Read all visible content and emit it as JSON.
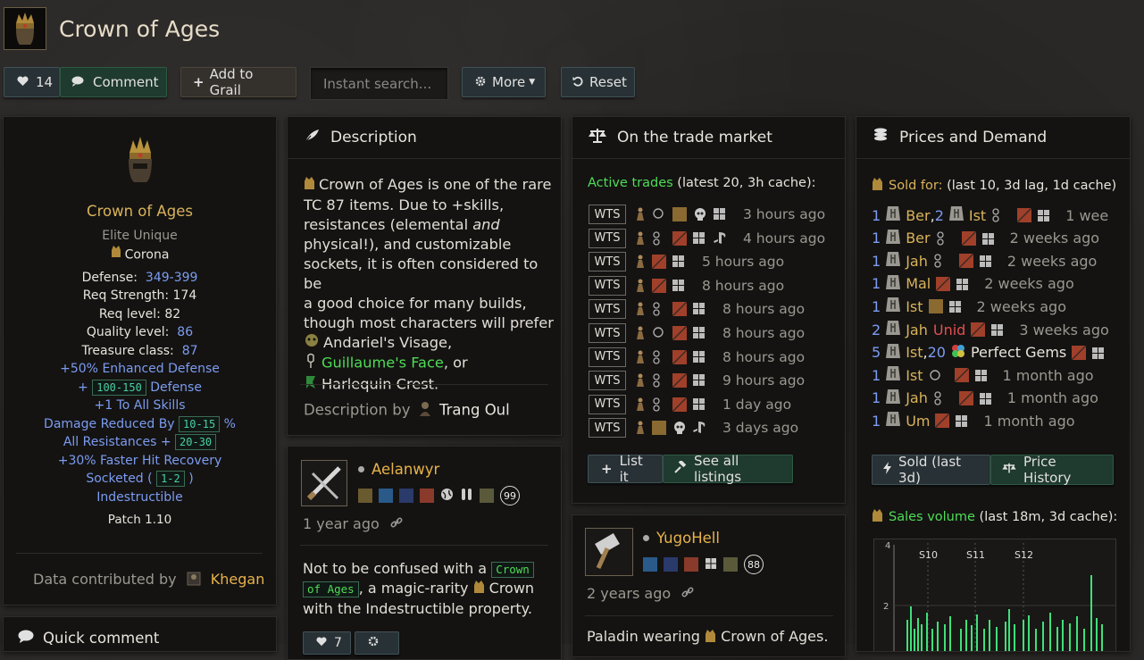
{
  "header": {
    "title": "Crown of Ages"
  },
  "toolbar": {
    "likes": "14",
    "comment": "Comment",
    "grail": "Add to Grail",
    "search_placeholder": "Instant search...",
    "more": "More",
    "reset": "Reset"
  },
  "item": {
    "name": "Crown of Ages",
    "rarity": "Elite Unique",
    "base": "Corona",
    "defense_label": "Defense:",
    "defense_value": "349-399",
    "req_str": "Req Strength: 174",
    "req_lvl": "Req level: 82",
    "quality_label": "Quality level:",
    "quality_value": "86",
    "tc_label": "Treasure class:",
    "tc_value": "87",
    "mods": {
      "ed": "+50% Enhanced Defense",
      "def_prefix": "+",
      "def_range": "100-150",
      "def_suffix": "Defense",
      "skills": "+1 To All Skills",
      "dr_prefix": "Damage Reduced By",
      "dr_range": "10-15",
      "dr_suffix": "%",
      "res_prefix": "All Resistances +",
      "res_range": "20-30",
      "fhr": "+30% Faster Hit Recovery",
      "sock_prefix": "Socketed (",
      "sock_range": "1-2",
      "sock_suffix": ")",
      "indestr": "Indestructible"
    },
    "patch": "Patch 1.10",
    "contrib_label": "Data contributed by",
    "contrib_user": "Khegan"
  },
  "quick_comment": {
    "title": "Quick comment"
  },
  "description": {
    "title": "Description",
    "line1_name": "Crown of Ages",
    "line1_rest": " is one of the rare",
    "line2": "TC 87 items. Due to +skills,",
    "line3_a": "resistances (elemental ",
    "line3_b": "and",
    "line4": "physical!), and customizable",
    "line5": "sockets, it is often considered to be",
    "line6": "a good choice for many builds,",
    "line7": "though most characters will prefer",
    "alt1": "Andariel's Visage,",
    "alt2": "Guillaume's Face",
    "alt2_suffix": ", or",
    "alt3": "Harlequin Crest.",
    "by_label": "Description by",
    "by_user": "Trang Oul"
  },
  "comment1": {
    "user": "Aelanwyr",
    "time": "1 year ago",
    "badge": "99",
    "text_a": "Not to be confused with a",
    "text_code1": "Crown",
    "text_code2": "of Ages",
    "text_b": ", a magic-rarity",
    "text_c": "Crown",
    "text_d": "with the Indestructible property.",
    "likes": "7"
  },
  "trade": {
    "title": "On the trade market",
    "active_label": "Active trades",
    "active_note": "(latest 20, 3h cache):",
    "rows": [
      {
        "tag": "WTS",
        "time": "3 hours ago"
      },
      {
        "tag": "WTS",
        "time": "4 hours ago"
      },
      {
        "tag": "WTS",
        "time": "5 hours ago"
      },
      {
        "tag": "WTS",
        "time": "8 hours ago"
      },
      {
        "tag": "WTS",
        "time": "8 hours ago"
      },
      {
        "tag": "WTS",
        "time": "8 hours ago"
      },
      {
        "tag": "WTS",
        "time": "8 hours ago"
      },
      {
        "tag": "WTS",
        "time": "9 hours ago"
      },
      {
        "tag": "WTS",
        "time": "1 day ago"
      },
      {
        "tag": "WTS",
        "time": "3 days ago"
      }
    ],
    "list_it": "List it",
    "see_all": "See all listings"
  },
  "comment2": {
    "user": "YugoHell",
    "time": "2 years ago",
    "badge": "88",
    "text_a": "Paladin wearing",
    "text_b": "Crown of Ages."
  },
  "prices": {
    "title": "Prices and Demand",
    "sold_label": "Sold for:",
    "sold_note": "(last 10, 3d lag, 1d cache)",
    "rows": [
      {
        "q": "1",
        "rune": "Ber",
        "extra_q": "2",
        "extra": "Ist",
        "time": "1 wee"
      },
      {
        "q": "1",
        "rune": "Ber",
        "time": "2 weeks ago"
      },
      {
        "q": "1",
        "rune": "Jah",
        "time": "2 weeks ago"
      },
      {
        "q": "1",
        "rune": "Mal",
        "time": "2 weeks ago"
      },
      {
        "q": "1",
        "rune": "Ist",
        "time": "2 weeks ago"
      },
      {
        "q": "2",
        "rune": "Jah",
        "unid": "Unid",
        "time": "3 weeks ago"
      },
      {
        "q": "5",
        "rune": "Ist",
        "extra_q": "20",
        "extra": "Perfect Gems",
        "time": ""
      },
      {
        "q": "1",
        "rune": "Ist",
        "time": "1 month ago"
      },
      {
        "q": "1",
        "rune": "Jah",
        "time": "1 month ago"
      },
      {
        "q": "1",
        "rune": "Um",
        "time": "1 month ago"
      }
    ],
    "sold_btn": "Sold (last 3d)",
    "history_btn": "Price History",
    "volume_label": "Sales volume",
    "volume_note": "(last 18m, 3d cache):"
  },
  "volume_chart": {
    "season_labels": [
      "S10",
      "S11",
      "S12"
    ],
    "y_ticks": [
      "2"
    ],
    "axis_top": "4"
  },
  "colors": {
    "accent_green": "#4fdc56",
    "link_blue": "#7c9cf0",
    "gold": "#d9b35a"
  }
}
